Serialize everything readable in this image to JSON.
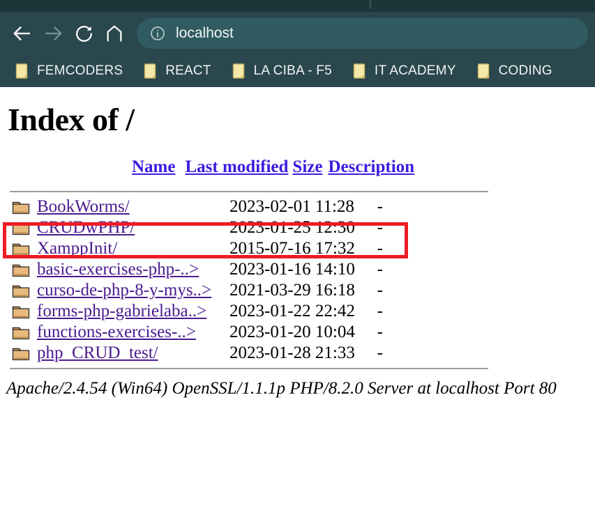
{
  "browser": {
    "nav": {
      "back_label": "Back",
      "forward_label": "Forward",
      "reload_label": "Reload",
      "home_label": "Home"
    },
    "address_bar": {
      "value": "localhost",
      "info_icon": "info-circle-icon"
    },
    "bookmarks": [
      {
        "label": "FEMCODERS",
        "icon": "folder-icon"
      },
      {
        "label": "REACT",
        "icon": "folder-icon"
      },
      {
        "label": "LA CIBA - F5",
        "icon": "folder-icon"
      },
      {
        "label": "IT ACADEMY",
        "icon": "folder-icon"
      },
      {
        "label": "CODING",
        "icon": "folder-icon"
      }
    ],
    "theme": {
      "tabstrip_bg": "#1e3538",
      "toolbar_bg": "#2a474d",
      "urlbar_bg": "#305b60",
      "text": "#eef3f4"
    }
  },
  "page": {
    "title": "Index of /",
    "columns": [
      "Name",
      "Last modified",
      "Size",
      "Description"
    ],
    "rows": [
      {
        "icon": "folder-icon",
        "name": "BookWorms/",
        "modified": "2023-02-01 11:28",
        "size": "-",
        "description": ""
      },
      {
        "icon": "folder-icon",
        "name": "CRUDwPHP/",
        "modified": "2023-01-25 12:30",
        "size": "-",
        "description": ""
      },
      {
        "icon": "folder-icon",
        "name": "XamppInit/",
        "modified": "2015-07-16 17:32",
        "size": "-",
        "description": ""
      },
      {
        "icon": "folder-icon",
        "name": "basic-exercises-php-..>",
        "modified": "2023-01-16 14:10",
        "size": "-",
        "description": ""
      },
      {
        "icon": "folder-icon",
        "name": "curso-de-php-8-y-mys..>",
        "modified": "2021-03-29 16:18",
        "size": "-",
        "description": ""
      },
      {
        "icon": "folder-icon",
        "name": "forms-php-gabrielaba..>",
        "modified": "2023-01-22 22:42",
        "size": "-",
        "description": ""
      },
      {
        "icon": "folder-icon",
        "name": "functions-exercises-..>",
        "modified": "2023-01-20 10:04",
        "size": "-",
        "description": ""
      },
      {
        "icon": "folder-icon",
        "name": "php_CRUD_test/",
        "modified": "2023-01-28 21:33",
        "size": "-",
        "description": ""
      }
    ],
    "footer": "Apache/2.4.54 (Win64) OpenSSL/1.1.1p PHP/8.2.0 Server at localhost Port 80",
    "link_color": "#4a1a8e",
    "header_link_color": "#3b1ce0"
  },
  "annotation": {
    "color": "#ed1c24",
    "target_row": "BookWorms/"
  }
}
